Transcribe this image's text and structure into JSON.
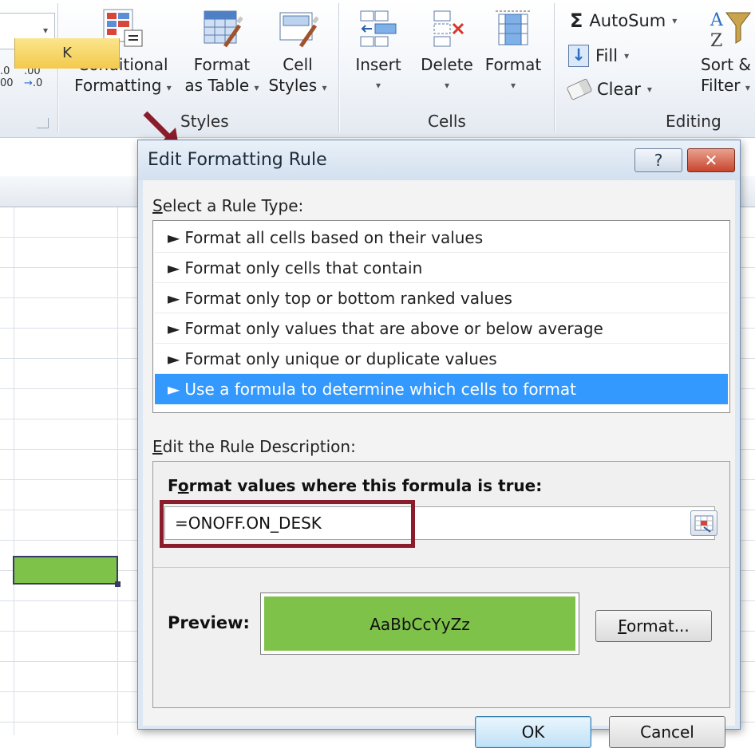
{
  "ribbon": {
    "number_format": {
      "increase_decimal": ".0\n.00",
      "decrease_decimal": ".00\n.0"
    },
    "styles_group": {
      "label": "Styles",
      "conditional_formatting": {
        "line1": "Conditional",
        "line2": "Formatting"
      },
      "format_as_table": {
        "line1": "Format",
        "line2": "as Table"
      },
      "cell_styles": {
        "line1": "Cell",
        "line2": "Styles"
      }
    },
    "cells_group": {
      "label": "Cells",
      "insert": "Insert",
      "delete": "Delete",
      "format": "Format"
    },
    "editing_group": {
      "label": "Editing",
      "autosum": "AutoSum",
      "fill": "Fill",
      "clear": "Clear",
      "sort_filter": {
        "line1": "Sort &",
        "line2": "Filter"
      }
    },
    "dropdown_glyph": "▾",
    "sigma_glyph": "Σ"
  },
  "sheet": {
    "column_header": "K",
    "selected_cell_fill": "#7fc24a"
  },
  "dialog": {
    "title": "Edit Formatting Rule",
    "help_glyph": "?",
    "close_glyph": "✕",
    "select_rule_type_label": {
      "accel": "S",
      "rest": "elect a Rule Type:"
    },
    "rule_types": [
      "Format all cells based on their values",
      "Format only cells that contain",
      "Format only top or bottom ranked values",
      "Format only values that are above or below average",
      "Format only unique or duplicate values",
      "Use a formula to determine which cells to format"
    ],
    "selected_rule_index": 5,
    "rule_arrow": "►",
    "edit_description_label": {
      "accel": "E",
      "rest": "dit the Rule Description:"
    },
    "formula_heading": {
      "pre": "F",
      "accel": "o",
      "post": "rmat values where this formula is true:"
    },
    "formula_value": "=ONOFF.ON_DESK",
    "preview_label": "Preview:",
    "preview_text": "AaBbCcYyZz",
    "preview_fill": "#7fc24a",
    "format_button": {
      "accel": "F",
      "rest": "ormat..."
    },
    "ok_button": "OK",
    "cancel_button": "Cancel"
  },
  "colors": {
    "selection_blue": "#3399ff",
    "highlight_box": "#8b1c2c",
    "arrow": "#8b1c2c"
  }
}
